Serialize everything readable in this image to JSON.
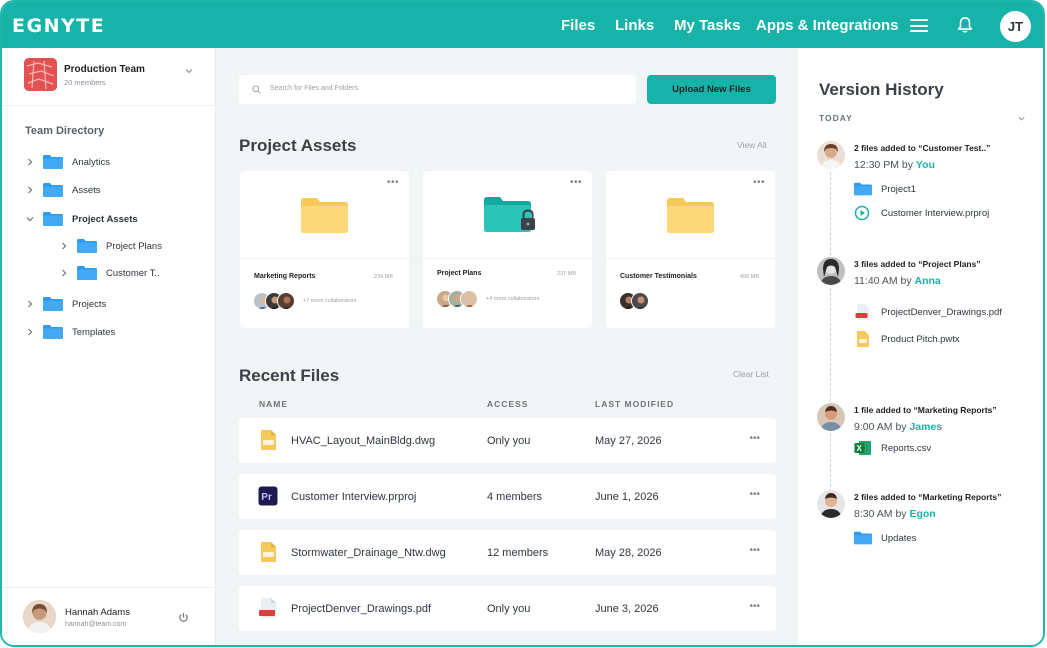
{
  "header": {
    "logo": "EGNYTE",
    "nav": [
      "Files",
      "Links",
      "My Tasks",
      "Apps & Integrations"
    ],
    "avatar_initials": "JT",
    "brand_color": "#17b3a9"
  },
  "sidebar": {
    "team_name": "Production Team",
    "team_members": "20 members",
    "directory_title": "Team Directory",
    "tree": [
      {
        "label": "Analytics",
        "expanded": false,
        "level": 0
      },
      {
        "label": "Assets",
        "expanded": false,
        "level": 0
      },
      {
        "label": "Project Assets",
        "expanded": true,
        "level": 0
      },
      {
        "label": "Project Plans",
        "expanded": false,
        "level": 1
      },
      {
        "label": "Customer T..",
        "expanded": false,
        "level": 1
      },
      {
        "label": "Projects",
        "expanded": false,
        "level": 0
      },
      {
        "label": "Templates",
        "expanded": false,
        "level": 0
      }
    ],
    "user": {
      "name": "Hannah Adams",
      "email": "hannah@team.com"
    }
  },
  "main": {
    "search_placeholder": "Search for Files and Folders",
    "upload_label": "Upload New Files",
    "assets_title": "Project Assets",
    "view_all": "View All",
    "cards": [
      {
        "name": "Marketing Reports",
        "size": "234 MB",
        "collaborators_text": "+7 more collaborators",
        "locked": false
      },
      {
        "name": "Project Plans",
        "size": "237 MB",
        "collaborators_text": "+4 more collaborators",
        "locked": true
      },
      {
        "name": "Customer Testimonials",
        "size": "456 MB",
        "collaborators_text": "",
        "locked": false
      }
    ],
    "recent_title": "Recent Files",
    "clear_list": "Clear List",
    "columns": [
      "NAME",
      "ACCESS",
      "LAST MODIFIED"
    ],
    "files": [
      {
        "name": "HVAC_Layout_MainBldg.dwg",
        "access": "Only you",
        "modified": "May 27, 2026",
        "icon": "dwg-file-icon"
      },
      {
        "name": "Customer Interview.prproj",
        "access": "4 members",
        "modified": "June 1, 2026",
        "icon": "premiere-file-icon"
      },
      {
        "name": "Stormwater_Drainage_Ntw.dwg",
        "access": "12 members",
        "modified": "May 28, 2026",
        "icon": "dwg-file-icon"
      },
      {
        "name": "ProjectDenver_Drawings.pdf",
        "access": "Only you",
        "modified": "June 3, 2026",
        "icon": "pdf-file-icon"
      }
    ]
  },
  "history": {
    "title": "Version History",
    "group": "TODAY",
    "events": [
      {
        "title": "2 files added to “Customer Test..”",
        "time": "12:30 PM by ",
        "who": "You",
        "files": [
          {
            "name": "Project1",
            "icon": "folder-icon"
          },
          {
            "name": "Customer Interview.prproj",
            "icon": "video-play-icon"
          }
        ]
      },
      {
        "title": "3 files added to “Project Plans”",
        "time": "11:40 AM by ",
        "who": "Anna",
        "files": [
          {
            "name": "ProjectDenver_Drawings.pdf",
            "icon": "pdf-file-icon"
          },
          {
            "name": "Product Pitch.pwtx",
            "icon": "pwtx-file-icon"
          }
        ]
      },
      {
        "title": "1 file added to “Marketing Reports”",
        "time": "9:00 AM by ",
        "who": "James",
        "files": [
          {
            "name": "Reports.csv",
            "icon": "excel-file-icon"
          }
        ]
      },
      {
        "title": "2 files added to “Marketing Reports”",
        "time": "8:30 AM by ",
        "who": "Egon",
        "files": [
          {
            "name": "Updates",
            "icon": "folder-icon"
          }
        ]
      }
    ]
  }
}
